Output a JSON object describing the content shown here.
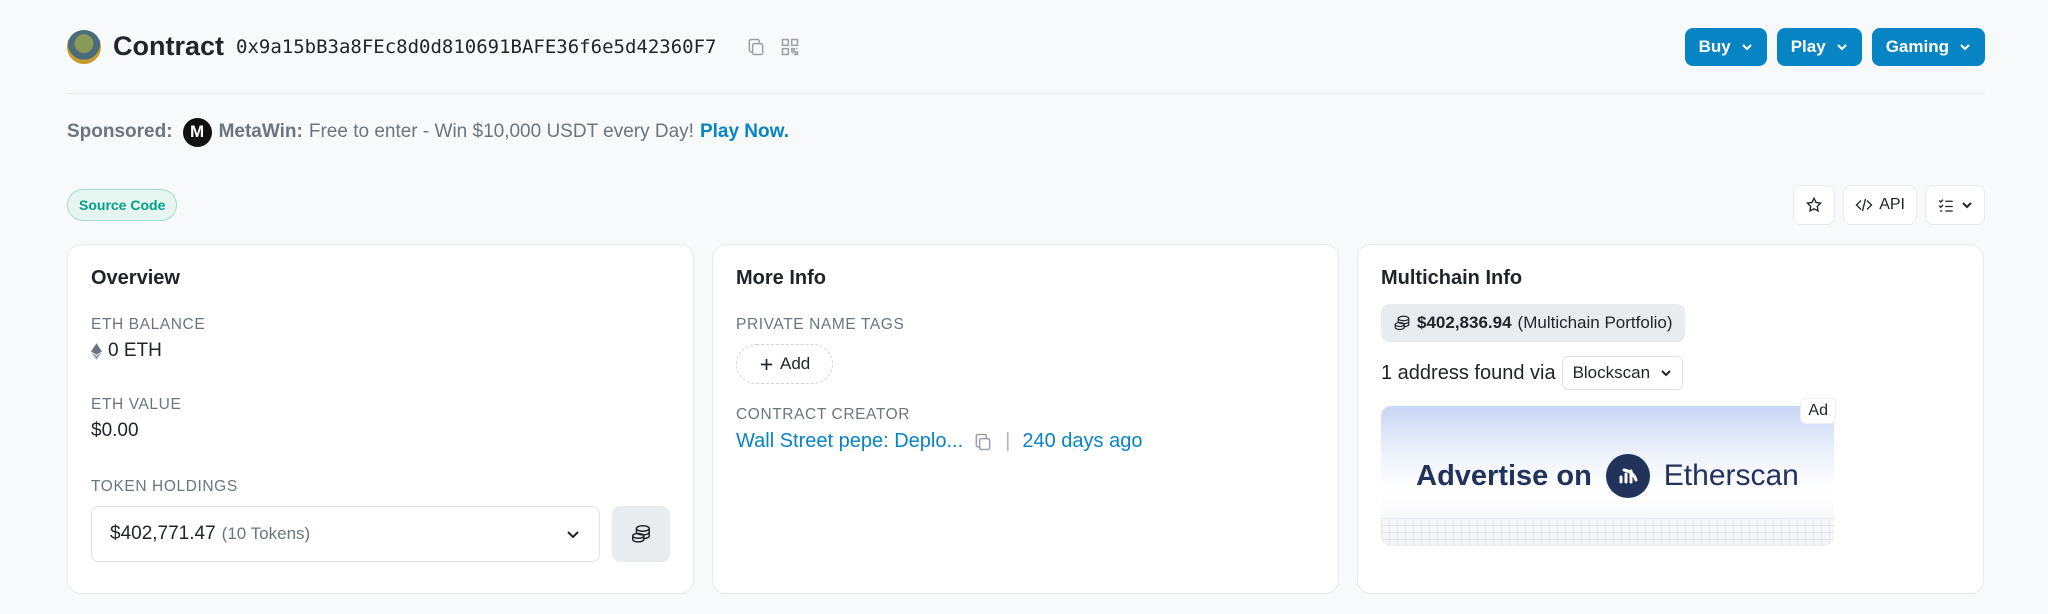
{
  "header": {
    "title": "Contract",
    "address": "0x9a15bB3a8FEc8d0d810691BAFE36f6e5d42360F7",
    "menus": [
      {
        "label": "Buy"
      },
      {
        "label": "Play"
      },
      {
        "label": "Gaming"
      }
    ]
  },
  "sponsored": {
    "label": "Sponsored:",
    "brand": "MetaWin:",
    "brand_logo_letter": "M",
    "text": "Free to enter - Win $10,000 USDT every Day!",
    "cta": "Play Now."
  },
  "tagbar": {
    "badge": "Source Code",
    "api_label": "API"
  },
  "overview": {
    "title": "Overview",
    "eth_balance_label": "ETH BALANCE",
    "eth_balance_value": "0 ETH",
    "eth_value_label": "ETH VALUE",
    "eth_value_value": "$0.00",
    "token_holdings_label": "TOKEN HOLDINGS",
    "token_holdings_value": "$402,771.47",
    "token_holdings_count": "(10 Tokens)"
  },
  "more_info": {
    "title": "More Info",
    "private_tags_label": "PRIVATE NAME TAGS",
    "add_label": "Add",
    "creator_label": "CONTRACT CREATOR",
    "creator_name": "Wall Street pepe: Deplo...",
    "creator_age": "240 days ago"
  },
  "multichain": {
    "title": "Multichain Info",
    "portfolio_value": "$402,836.94",
    "portfolio_label": "(Multichain Portfolio)",
    "found_text": "1 address found via",
    "found_select": "Blockscan",
    "ad_tag": "Ad",
    "ad_text": "Advertise on",
    "ad_brand": "Etherscan"
  },
  "colors": {
    "primary": "#0784c3",
    "badge_green": "#00a186",
    "background": "#f8f9fb"
  }
}
